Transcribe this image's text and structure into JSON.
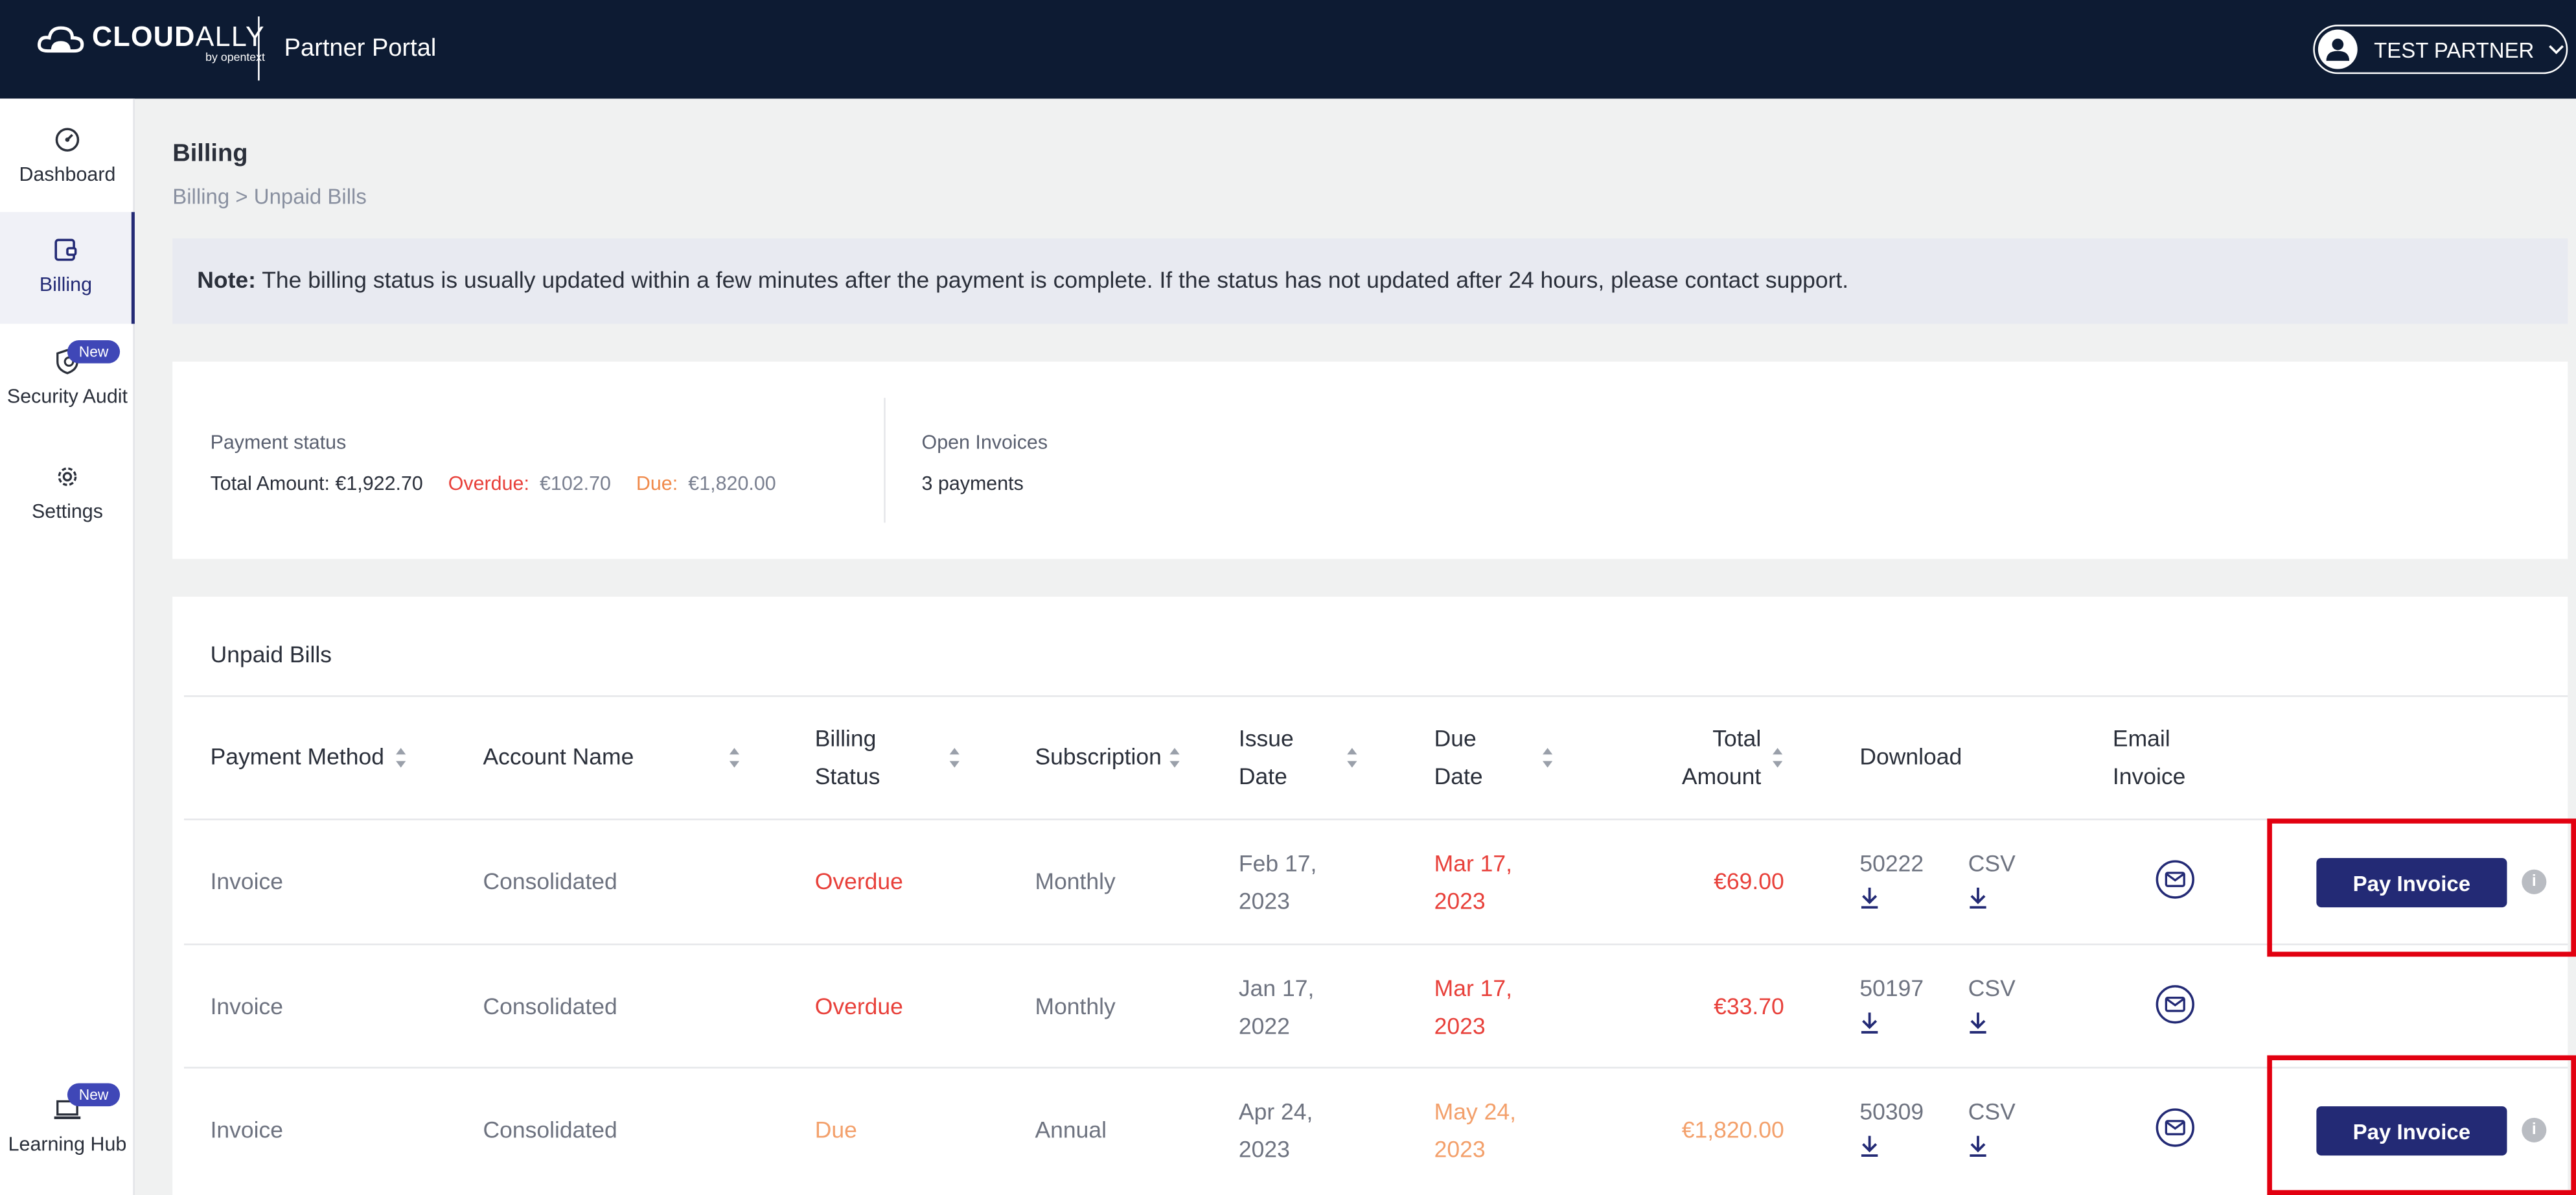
{
  "header": {
    "logo_main": "CLOUD",
    "logo_main_thin": "ALLY",
    "logo_sub": "by opentext",
    "portal_title": "Partner Portal",
    "user_name": "TEST PARTNER"
  },
  "sidebar": {
    "items": [
      {
        "label": "Dashboard",
        "icon": "dashboard-icon"
      },
      {
        "label": "Billing",
        "icon": "billing-icon",
        "active": true
      },
      {
        "label": "Security Audit",
        "icon": "security-audit-icon",
        "badge": "New"
      },
      {
        "label": "Settings",
        "icon": "gear-icon"
      },
      {
        "label": "Learning Hub",
        "icon": "laptop-icon",
        "badge": "New"
      }
    ]
  },
  "page": {
    "title": "Billing",
    "breadcrumb": "Billing > Unpaid Bills",
    "note_bold": "Note:",
    "note_text": " The billing status is usually updated within a few minutes after the payment is complete. If the status has not updated after 24 hours, please contact support."
  },
  "payment_status": {
    "label": "Payment status",
    "total_label": "Total Amount:",
    "total_value": "€1,922.70",
    "overdue_label": "Overdue:",
    "overdue_value": "€102.70",
    "due_label": "Due:",
    "due_value": "€1,820.00",
    "open_invoices_label": "Open Invoices",
    "open_invoices_value": "3 payments"
  },
  "bills": {
    "title": "Unpaid Bills",
    "columns": {
      "payment_method": "Payment Method",
      "account_name": "Account Name",
      "billing_status_1": "Billing",
      "billing_status_2": "Status",
      "subscription": "Subscription",
      "issue_date_1": "Issue",
      "issue_date_2": "Date",
      "due_date_1": "Due",
      "due_date_2": "Date",
      "total_amount_1": "Total",
      "total_amount_2": "Amount",
      "download": "Download",
      "email_invoice_1": "Email",
      "email_invoice_2": "Invoice"
    },
    "rows": [
      {
        "method": "Invoice",
        "account": "Consolidated",
        "status": "Overdue",
        "subscription": "Monthly",
        "issue_1": "Feb 17,",
        "issue_2": "2023",
        "due_1": "Mar 17,",
        "due_2": "2023",
        "amount": "€69.00",
        "invoice_no": "50222",
        "csv": "CSV",
        "pay_label": "Pay Invoice",
        "info": "i"
      },
      {
        "method": "Invoice",
        "account": "Consolidated",
        "status": "Overdue",
        "subscription": "Monthly",
        "issue_1": "Jan 17,",
        "issue_2": "2022",
        "due_1": "Mar 17,",
        "due_2": "2023",
        "amount": "€33.70",
        "invoice_no": "50197",
        "csv": "CSV"
      },
      {
        "method": "Invoice",
        "account": "Consolidated",
        "status": "Due",
        "subscription": "Annual",
        "issue_1": "Apr 24,",
        "issue_2": "2023",
        "due_1": "May 24,",
        "due_2": "2023",
        "amount": "€1,820.00",
        "invoice_no": "50309",
        "csv": "CSV",
        "pay_label": "Pay Invoice",
        "info": "i"
      }
    ]
  },
  "colors": {
    "topbar": "#0d1b33",
    "accent": "#232a75",
    "overdue": "#e8403a",
    "due": "#f3a06b",
    "highlight": "#e20010"
  }
}
